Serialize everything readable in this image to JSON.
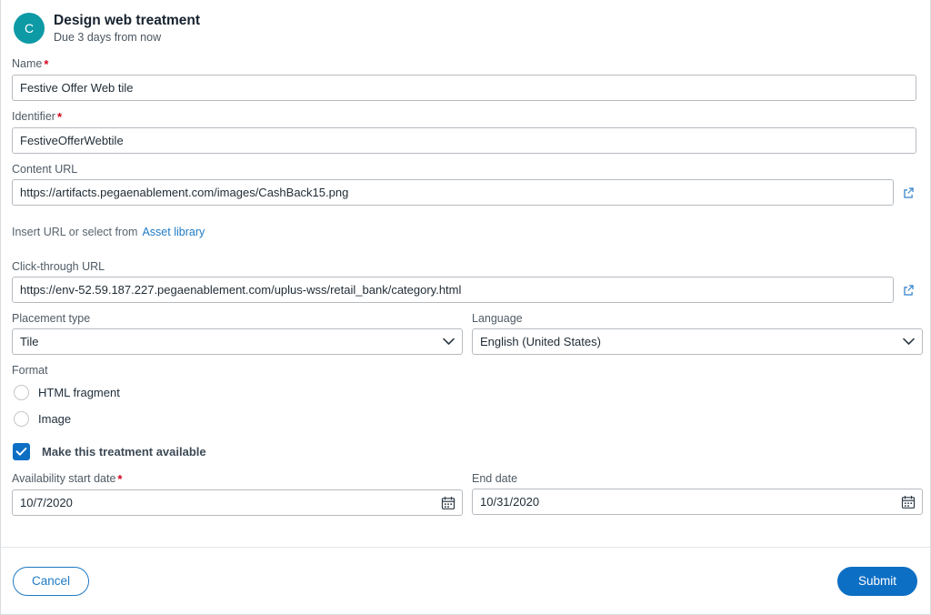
{
  "header": {
    "avatar_initial": "C",
    "avatar_color": "#0d9aa5",
    "title": "Design web treatment",
    "subtitle": "Due 3 days from now"
  },
  "form": {
    "name": {
      "label": "Name",
      "required": true,
      "value": "Festive Offer Web tile",
      "placeholder": ""
    },
    "identifier": {
      "label": "Identifier",
      "required": true,
      "value": "FestiveOfferWebtile",
      "placeholder": ""
    },
    "content_url": {
      "label": "Content URL",
      "required": false,
      "value": "https://artifacts.pegaenablement.com/images/CashBack15.png",
      "placeholder": "",
      "action_icon": "external-link-icon"
    },
    "helper": {
      "text": "Insert URL or select from",
      "link_label": "Asset library"
    },
    "click_through_url": {
      "label": "Click-through URL",
      "required": false,
      "value": "https://env-52.59.187.227.pegaenablement.com/uplus-wss/retail_bank/category.html",
      "placeholder": "",
      "action_icon": "external-link-icon"
    },
    "placement_type": {
      "label": "Placement type",
      "required": false,
      "selected": "Tile",
      "options": [
        "Tile"
      ]
    },
    "language": {
      "label": "Language",
      "required": false,
      "selected": "English (United States)",
      "options": [
        "English (United States)"
      ]
    },
    "format": {
      "label": "Format",
      "options": [
        {
          "label": "HTML fragment",
          "selected": false
        },
        {
          "label": "Image",
          "selected": false
        }
      ]
    },
    "availability_checkbox": {
      "label": "Make this treatment available",
      "checked": true,
      "color": "#0d6fc4"
    },
    "start_date": {
      "label": "Availability start date",
      "required": true,
      "value": "10/7/2020",
      "placeholder": "",
      "icon": "calendar-icon"
    },
    "end_date": {
      "label": "End date",
      "required": false,
      "value": "10/31/2020",
      "placeholder": "",
      "icon": "calendar-icon"
    }
  },
  "footer": {
    "cancel_label": "Cancel",
    "submit_label": "Submit",
    "primary_color": "#0d6fc4"
  }
}
